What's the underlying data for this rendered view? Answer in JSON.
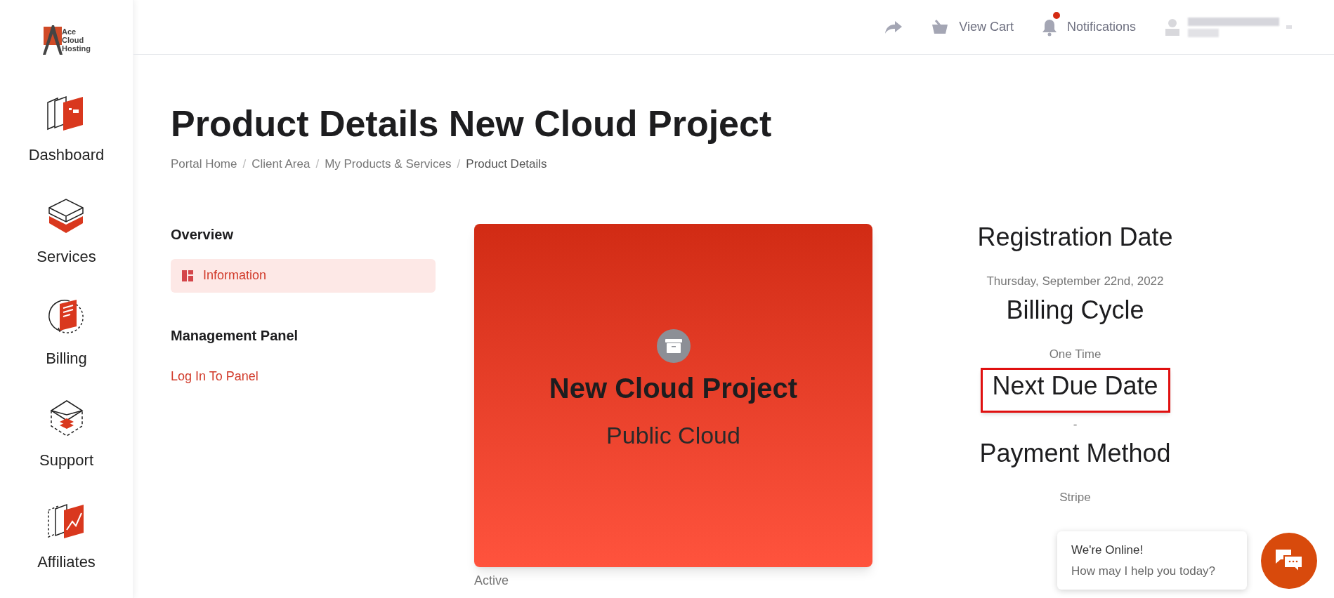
{
  "sidebar": {
    "logo": {
      "lines": [
        "Ace",
        "Cloud",
        "Hosting"
      ]
    },
    "items": [
      {
        "kind": "dashboard",
        "label": "Dashboard"
      },
      {
        "kind": "services",
        "label": "Services"
      },
      {
        "kind": "billing",
        "label": "Billing"
      },
      {
        "kind": "support",
        "label": "Support"
      },
      {
        "kind": "affiliates",
        "label": "Affiliates"
      }
    ]
  },
  "top_bar": {
    "items": [
      {
        "kind": "share"
      },
      {
        "kind": "cart",
        "label": "View Cart"
      },
      {
        "kind": "bell",
        "label": "Notifications",
        "badge": true
      },
      {
        "kind": "user"
      }
    ]
  },
  "page": {
    "title": "Product Details New Cloud Project",
    "breadcrumb": [
      {
        "label": "Portal Home"
      },
      {
        "separator": "/",
        "label": "Client Area"
      },
      {
        "separator": "/",
        "label": "My Products & Services"
      },
      {
        "separator": "/",
        "label": "Product Details"
      }
    ]
  },
  "left_nav": {
    "sections": [
      {
        "heading": "Overview",
        "items": [
          {
            "label": "Information",
            "selected": true,
            "icon": true
          }
        ]
      },
      {
        "heading": "Management Panel",
        "items": [
          {
            "label": "Log In To Panel",
            "selected": false,
            "icon": false
          }
        ]
      }
    ]
  },
  "product_card": {
    "name": "New Cloud Project",
    "group": "Public Cloud",
    "status": "Active"
  },
  "details": [
    {
      "label": "Registration Date",
      "value": "Thursday, September 22nd, 2022",
      "highlighted": false
    },
    {
      "label": "Billing Cycle",
      "value": "One Time",
      "highlighted": false
    },
    {
      "label": "Next Due Date",
      "value": "-",
      "highlighted": true
    },
    {
      "label": "Payment Method",
      "value": "Stripe",
      "highlighted": false
    }
  ],
  "chat": {
    "title": "We're Online!",
    "subtitle": "How may I help you today?"
  }
}
